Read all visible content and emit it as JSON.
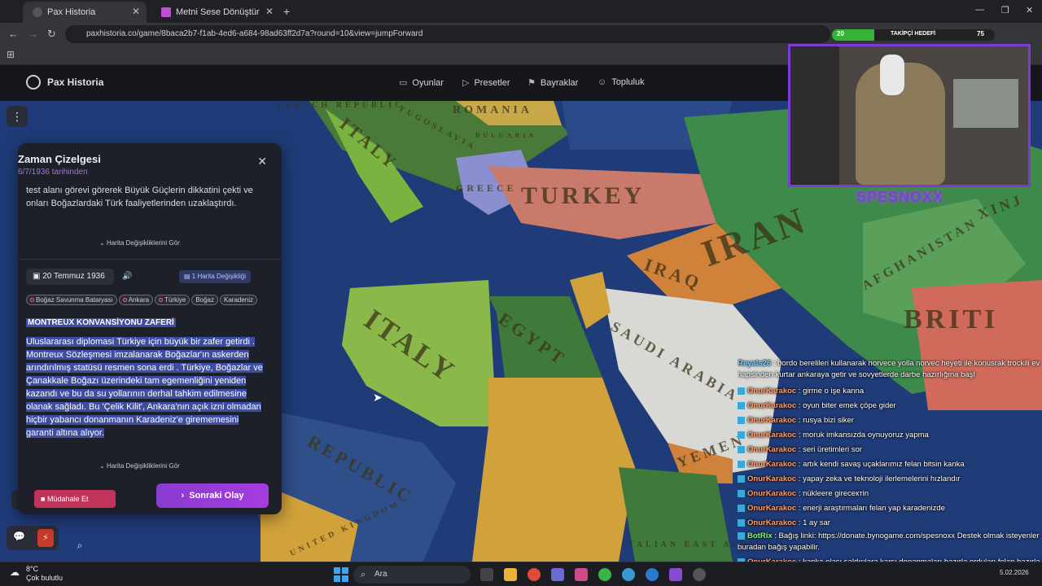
{
  "browser": {
    "tabs": [
      {
        "label": "Pax Historia",
        "active": true
      },
      {
        "label": "Metni Sese Dönüştür",
        "active": false
      }
    ],
    "url": "paxhistoria.co/game/8baca2b7-f1ab-4ed6-a684-98ad63ff2d7a?round=10&view=jumpForward"
  },
  "header": {
    "logo": "Pax Historia",
    "nav": [
      "Oyunlar",
      "Presetler",
      "Bayraklar",
      "Topluluk"
    ]
  },
  "map": {
    "labels": [
      "ROMANIA",
      "YUGOSLAVIA",
      "BULGARIA",
      "ITALY",
      "TURKEY",
      "GREECE",
      "IRAN",
      "IRAQ",
      "ITALY",
      "EGYPT",
      "SAUDI ARABIA",
      "AFGHANISTAN",
      "BRITI",
      "XINJ",
      "YEMEN",
      "REPUBLIC",
      "UNITED KINGDOM",
      "ITALIAN EAST AFRICA",
      "FRENCH REPUBLIC"
    ]
  },
  "timeline": {
    "title": "Zaman Çizelgesi",
    "subtitle": "6/7/1936 tarihinden",
    "prev_text": "test alanı görevi görerek Büyük Güçlerin dikkatini çekti ve onları Boğazlardaki Türk faaliyetlerinden uzaklaştırdı.",
    "map_changes_link": "Harita Değişikliklerini Gör",
    "entry": {
      "date": "20 Temmuz 1936",
      "map_change_badge": "1 Harita Değişikliği",
      "tags": [
        "Boğaz Savunma Bataryası",
        "Ankara",
        "Türkiye",
        "Boğaz",
        "Karadeniz"
      ],
      "headline": "MONTREUX KONVANSİYONU ZAFERİ",
      "body": "Uluslararası diplomasi Türkiye için büyük bir zafer getirdi . Montreux Sözleşmesi imzalanarak Boğazlar'ın askerden arındırılmış statüsü resmen sona erdi . Türkiye, Boğazlar ve Çanakkale Boğazı üzerindeki tam egemenliğini yeniden kazandı ve bu da su yollarının derhal tahkim edilmesine olanak sağladı. Bu 'Çelik Kilit', Ankara'nın açık izni olmadan hiçbir yabancı donanmanın Karadeniz'e girememesini garanti altına alıyor."
    },
    "map_changes_link2": "Harita Değişikliklerini Gör",
    "intervene_button": "Müdahale Et",
    "next_button": "Sonraki Olay"
  },
  "stream": {
    "follower_goal_label": "TAKİPÇİ HEDEFİ",
    "follower_current": "20",
    "follower_target": "75",
    "logo_text": "SPESNOXX"
  },
  "chat": [
    {
      "user": "Reyals26",
      "text": "bordo berelileri kullanarak norvece yolla norvec heyeti ile konusrak trockili ev hapsinden kurtar ankaraya getir ve sovyetlerde darbe hazırlığına başl",
      "color": "b"
    },
    {
      "user": "OnurKarakoc",
      "text": "girme o işe kanna",
      "color": "a"
    },
    {
      "user": "OnurKarakoc",
      "text": "oyun biter emek çöpe gider",
      "color": "a"
    },
    {
      "user": "OnurKarakoc",
      "text": "rusya bizi siker",
      "color": "a"
    },
    {
      "user": "OnurKarakoc",
      "text": "moruk imkansızda oynuyoruz yapma",
      "color": "a"
    },
    {
      "user": "OnurKarakoc",
      "text": "seri üretimleri sor",
      "color": "a"
    },
    {
      "user": "OnurKarakoc",
      "text": "artık kendi savaş uçaklarımız felan bitsin kanka",
      "color": "a"
    },
    {
      "user": "OnurKarakoc",
      "text": "yapay zeka ve teknoloji ilerlemelerini hızlandır",
      "color": "a"
    },
    {
      "user": "OnurKarakoc",
      "text": "nükleere gireceктin",
      "color": "a"
    },
    {
      "user": "OnurKarakoc",
      "text": "enerji araştırmaları felan yap karadenizde",
      "color": "a"
    },
    {
      "user": "OnurKarakoc",
      "text": "1 ay sar",
      "color": "a"
    },
    {
      "user": "BotRix",
      "text": "Bağış linki: https://donate.bynogame.com/spesnoxx Destek olmak isteyenler buradan bağış yapabilir.",
      "color": "c"
    },
    {
      "user": "OnurKarakoc",
      "text": "kanka olası saldırılara karşı donanmaları hazırla orduları felan hazırla en ufak şeyde hazır olsunlar",
      "color": "a"
    }
  ],
  "taskbar": {
    "weather_temp": "8°C",
    "weather_desc": "Çok bulutlu",
    "search_placeholder": "Ara",
    "date": "5.02.2026"
  }
}
